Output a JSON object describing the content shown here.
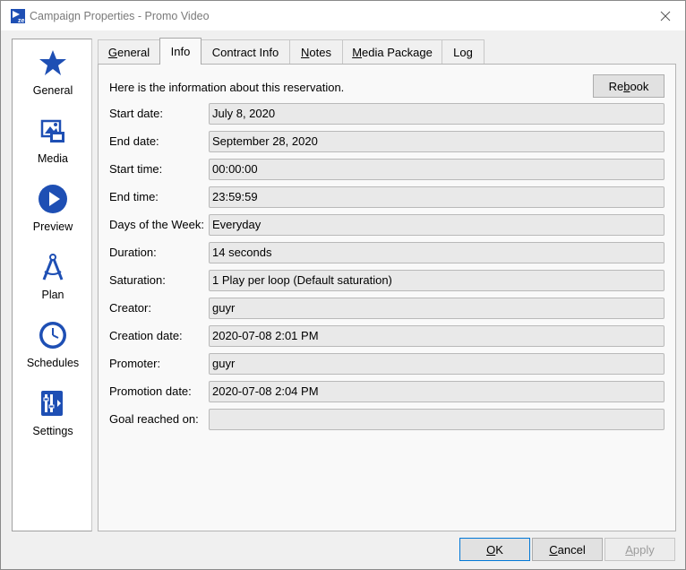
{
  "window": {
    "title": "Campaign Properties - Promo Video",
    "close_glyph": "✕"
  },
  "sidebar": {
    "items": [
      {
        "label": "General",
        "icon": "star-icon"
      },
      {
        "label": "Media",
        "icon": "media-icon"
      },
      {
        "label": "Preview",
        "icon": "play-icon"
      },
      {
        "label": "Plan",
        "icon": "compass-icon"
      },
      {
        "label": "Schedules",
        "icon": "clock-icon"
      },
      {
        "label": "Settings",
        "icon": "settings-icon"
      }
    ],
    "icon_color": "#1e4fb4"
  },
  "tabs": [
    {
      "label": "General",
      "underline_char": "G",
      "rest": "eneral"
    },
    {
      "label": "Info",
      "active": true
    },
    {
      "label": "Contract Info"
    },
    {
      "label": "Notes",
      "underline_char": "N",
      "rest": "otes"
    },
    {
      "label": "Media Package",
      "underline_char": "M",
      "rest": "edia Package"
    },
    {
      "label": "Log"
    }
  ],
  "info": {
    "intro": "Here is the information about this reservation.",
    "rebook_button": {
      "pre": "Re",
      "underline_char": "b",
      "post": "ook"
    },
    "fields": [
      {
        "label": "Start date:",
        "value": "July 8, 2020"
      },
      {
        "label": "End date:",
        "value": "September 28, 2020"
      },
      {
        "label": "Start time:",
        "value": "00:00:00"
      },
      {
        "label": "End time:",
        "value": "23:59:59"
      },
      {
        "label": "Days of the Week:",
        "value": "Everyday"
      },
      {
        "label": "Duration:",
        "value": "14 seconds"
      },
      {
        "label": "Saturation:",
        "value": "1 Play per loop (Default saturation)"
      },
      {
        "label": "Creator:",
        "value": "guyr"
      },
      {
        "label": "Creation date:",
        "value": "2020-07-08 2:01 PM"
      },
      {
        "label": "Promoter:",
        "value": "guyr"
      },
      {
        "label": "Promotion date:",
        "value": "2020-07-08 2:04 PM"
      },
      {
        "label": "Goal reached on:",
        "value": ""
      }
    ]
  },
  "footer": {
    "ok": {
      "underline_char": "O",
      "rest": "K"
    },
    "cancel": {
      "underline_char": "C",
      "rest": "ancel"
    },
    "apply": {
      "underline_char": "A",
      "rest": "pply"
    }
  }
}
